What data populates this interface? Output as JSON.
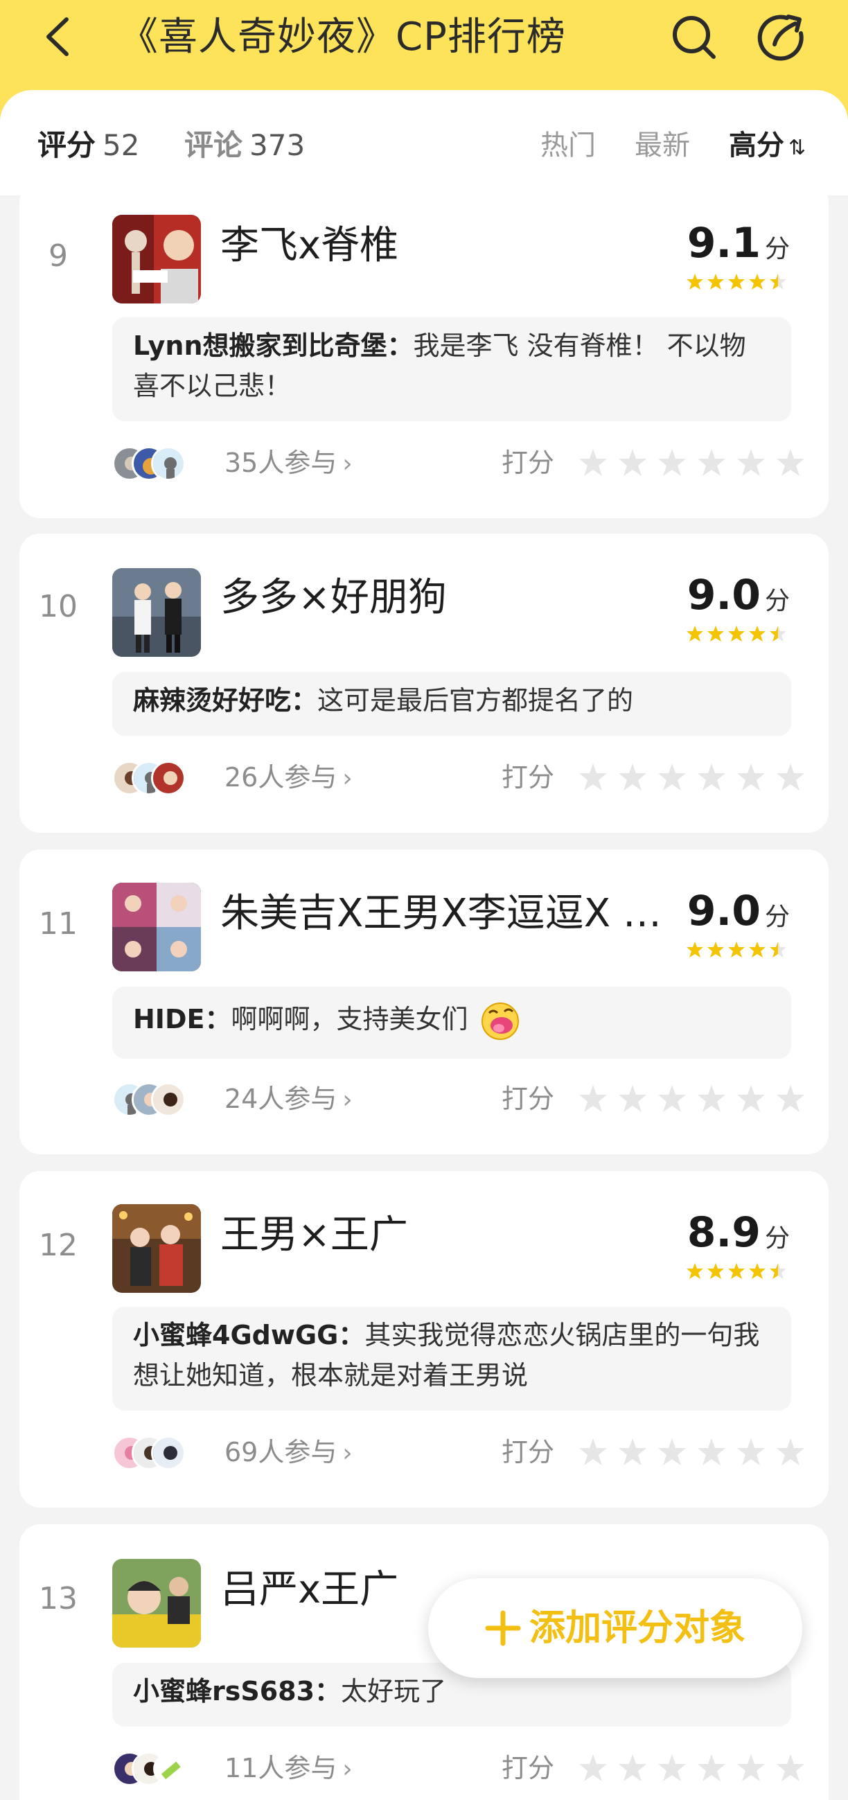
{
  "header": {
    "title": "《喜人奇妙夜》CP排行榜",
    "accent_color": "#fde35a"
  },
  "tabs": {
    "score_label": "评分",
    "score_count": "52",
    "comment_label": "评论",
    "comment_count": "373"
  },
  "sort": {
    "hot": "热门",
    "newest": "最新",
    "high": "高分",
    "high_icon": "⇅"
  },
  "list": [
    {
      "rank": "9",
      "name": "李飞x脊椎",
      "score": "9.1",
      "unit": "分",
      "stars_filled": 4.5,
      "comment_author": "Lynn想搬家到比奇堡：",
      "comment_text": "我是李飞 没有脊椎！ 不以物喜不以己悲！",
      "participants": "35人参与",
      "rate_label": "打分"
    },
    {
      "rank": "10",
      "name": "多多×好朋狗",
      "score": "9.0",
      "unit": "分",
      "stars_filled": 4.5,
      "comment_author": "麻辣烫好好吃：",
      "comment_text": "这可是最后官方都提名了的",
      "participants": "26人参与",
      "rate_label": "打分"
    },
    {
      "rank": "11",
      "name": "朱美吉X王男X李逗逗X …",
      "score": "9.0",
      "unit": "分",
      "stars_filled": 4.5,
      "comment_author": "HIDE：",
      "comment_text": "啊啊啊，支持美女们",
      "participants": "24人参与",
      "rate_label": "打分"
    },
    {
      "rank": "12",
      "name": "王男×王广",
      "score": "8.9",
      "unit": "分",
      "stars_filled": 4.5,
      "comment_author": "小蜜蜂4GdwGG：",
      "comment_text": "其实我觉得恋恋火锅店里的一句我想让她知道，根本就是对着王男说",
      "participants": "69人参与",
      "rate_label": "打分"
    },
    {
      "rank": "13",
      "name": "吕严x王广",
      "comment_author": "小蜜蜂rsS683：",
      "comment_text": "太好玩了",
      "participants": "11人参与",
      "rate_label": "打分"
    }
  ],
  "fab": {
    "label": "添加评分对象",
    "plus": "+"
  },
  "icons": {
    "back": "chevron-left-icon",
    "search": "search-icon",
    "share": "share-icon",
    "star": "star-icon"
  },
  "colors": {
    "gold": "#f5c400",
    "star_empty": "#e6e6e6",
    "fab_text": "#f2bf12"
  }
}
